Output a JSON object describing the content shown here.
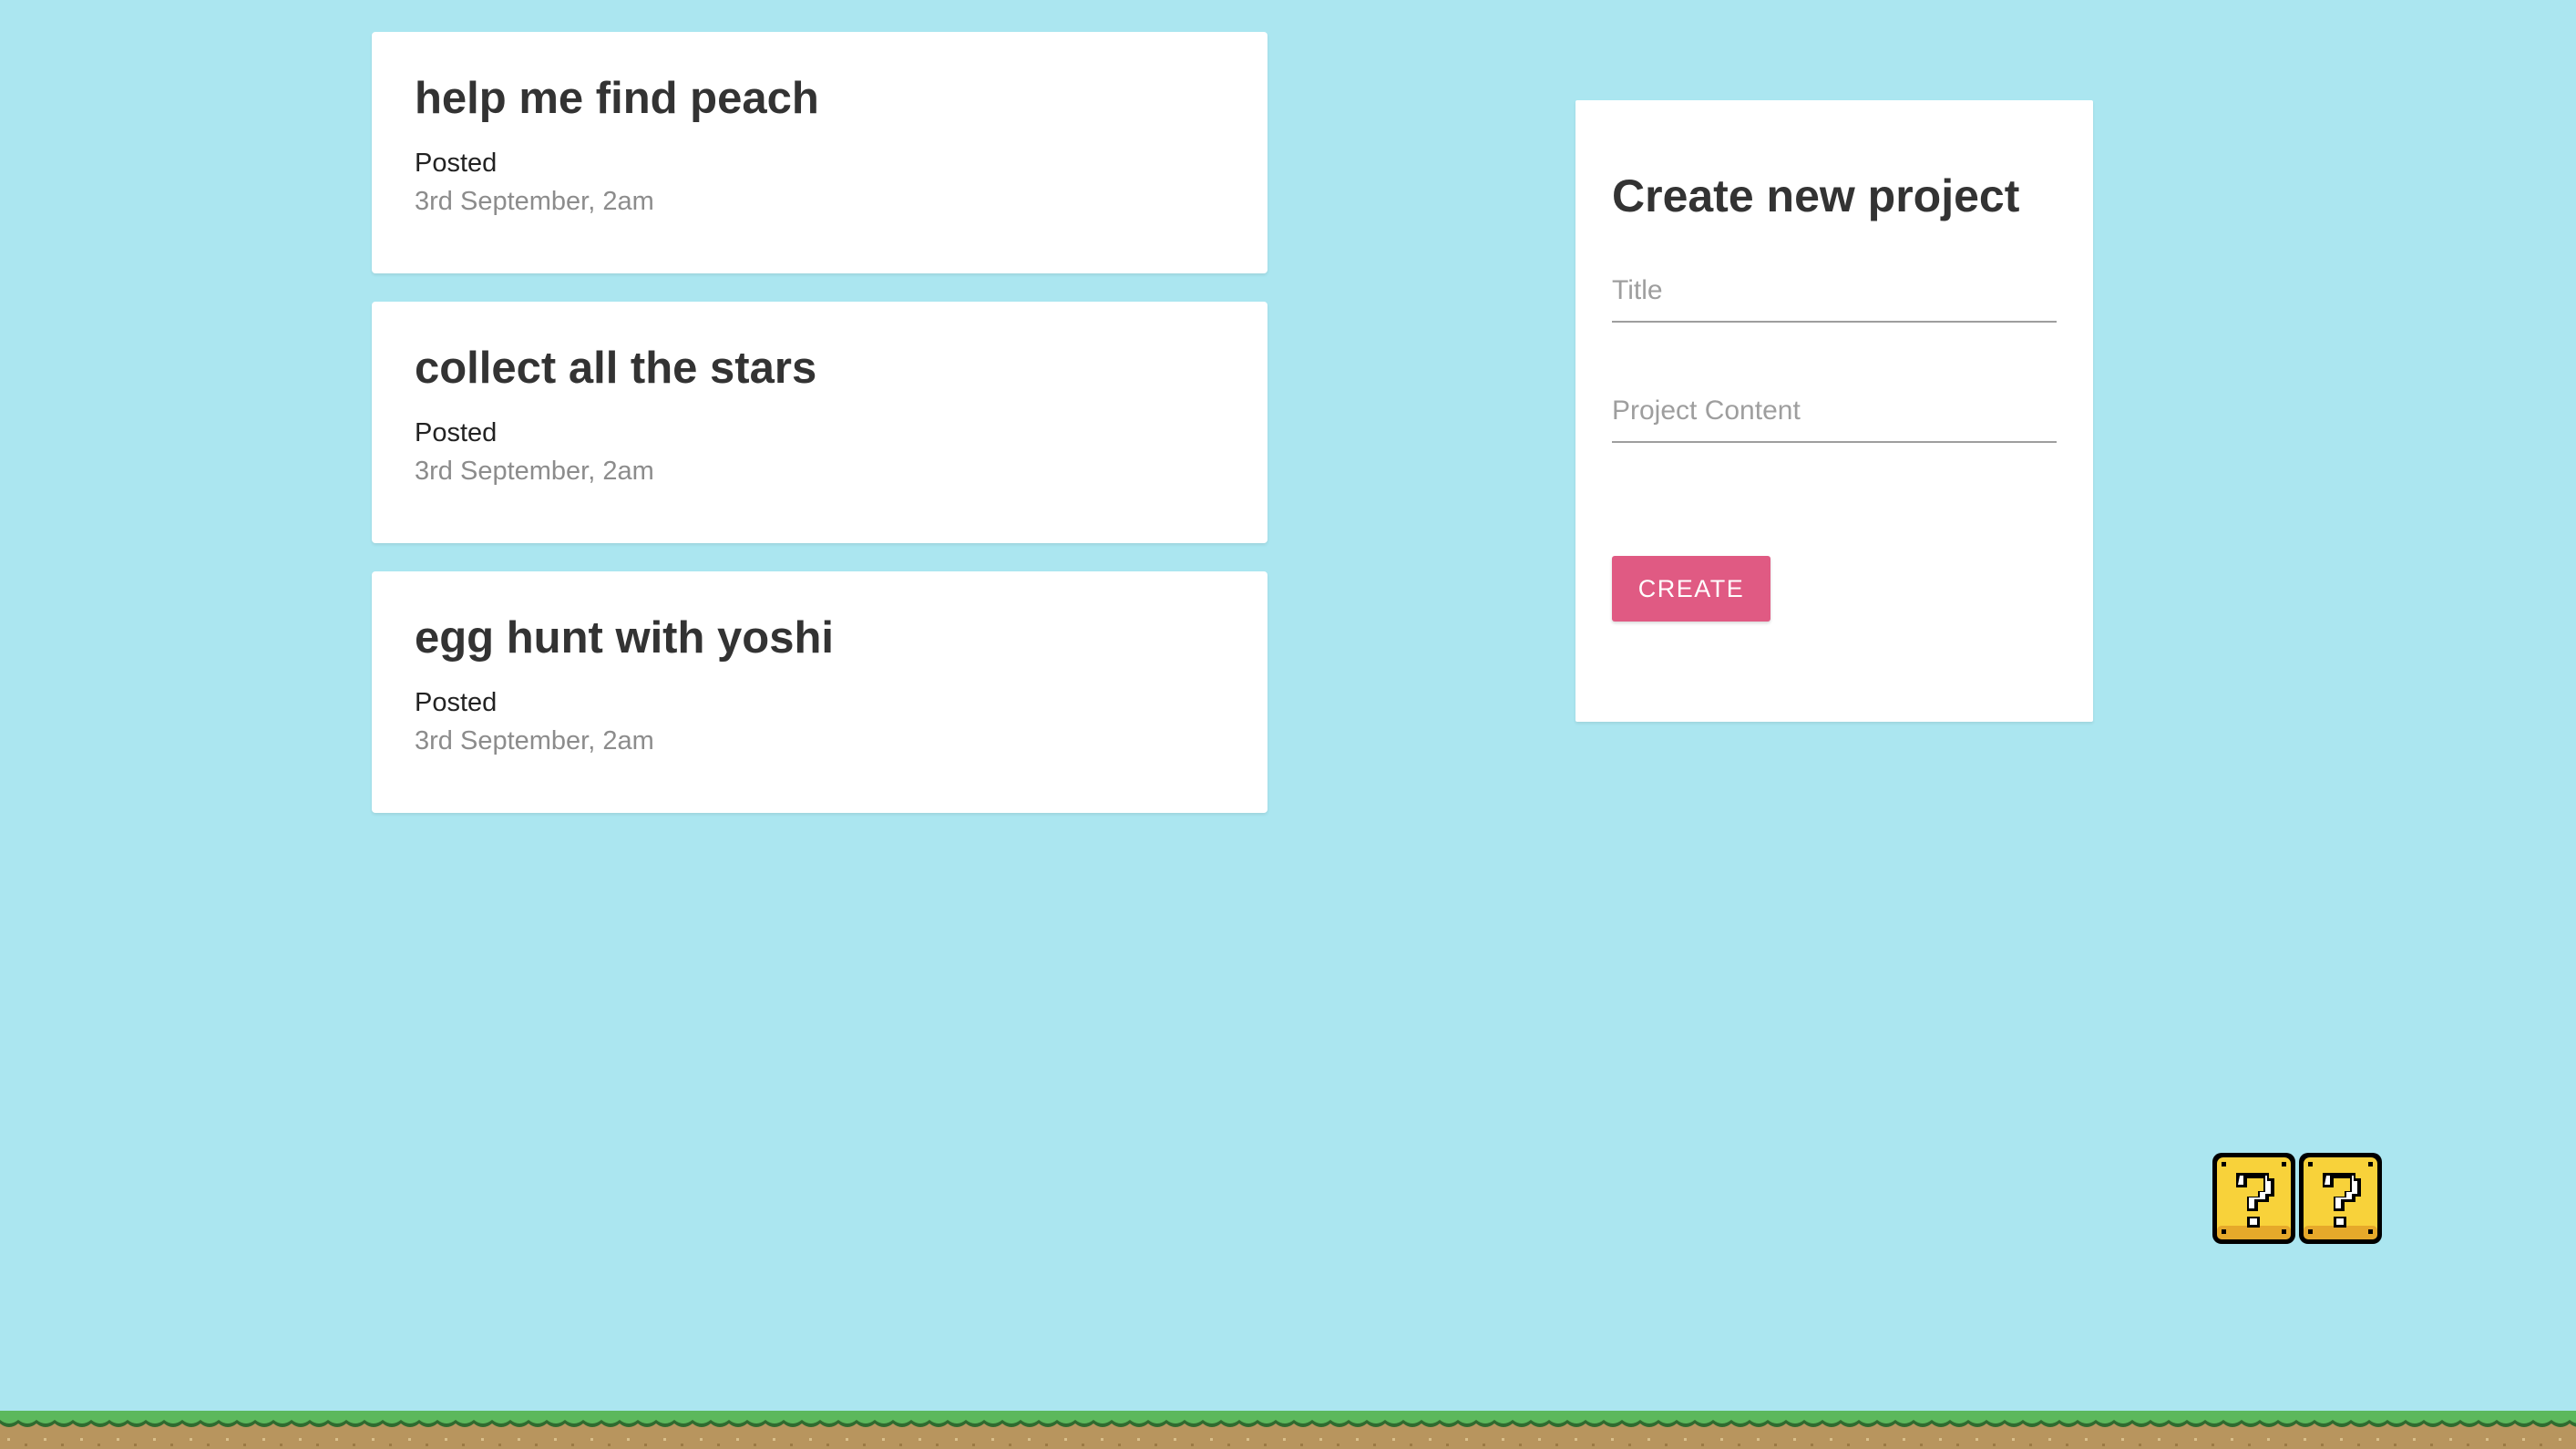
{
  "projects": [
    {
      "title": "help me find peach",
      "posted_label": "Posted",
      "date": "3rd September, 2am"
    },
    {
      "title": "collect all the stars",
      "posted_label": "Posted",
      "date": "3rd September, 2am"
    },
    {
      "title": "egg hunt with yoshi",
      "posted_label": "Posted",
      "date": "3rd September, 2am"
    }
  ],
  "create_form": {
    "heading": "Create new project",
    "title_placeholder": "Title",
    "content_placeholder": "Project Content",
    "title_value": "",
    "content_value": "",
    "submit_label": "CREATE"
  },
  "decorations": {
    "question_blocks": [
      "question-block-icon",
      "question-block-icon"
    ],
    "ground": "grass-ground"
  },
  "colors": {
    "background": "#abe6f0",
    "button": "#e05a83",
    "block_yellow": "#f8d23a",
    "grass": "#5cb85c",
    "dirt": "#b8955e"
  }
}
